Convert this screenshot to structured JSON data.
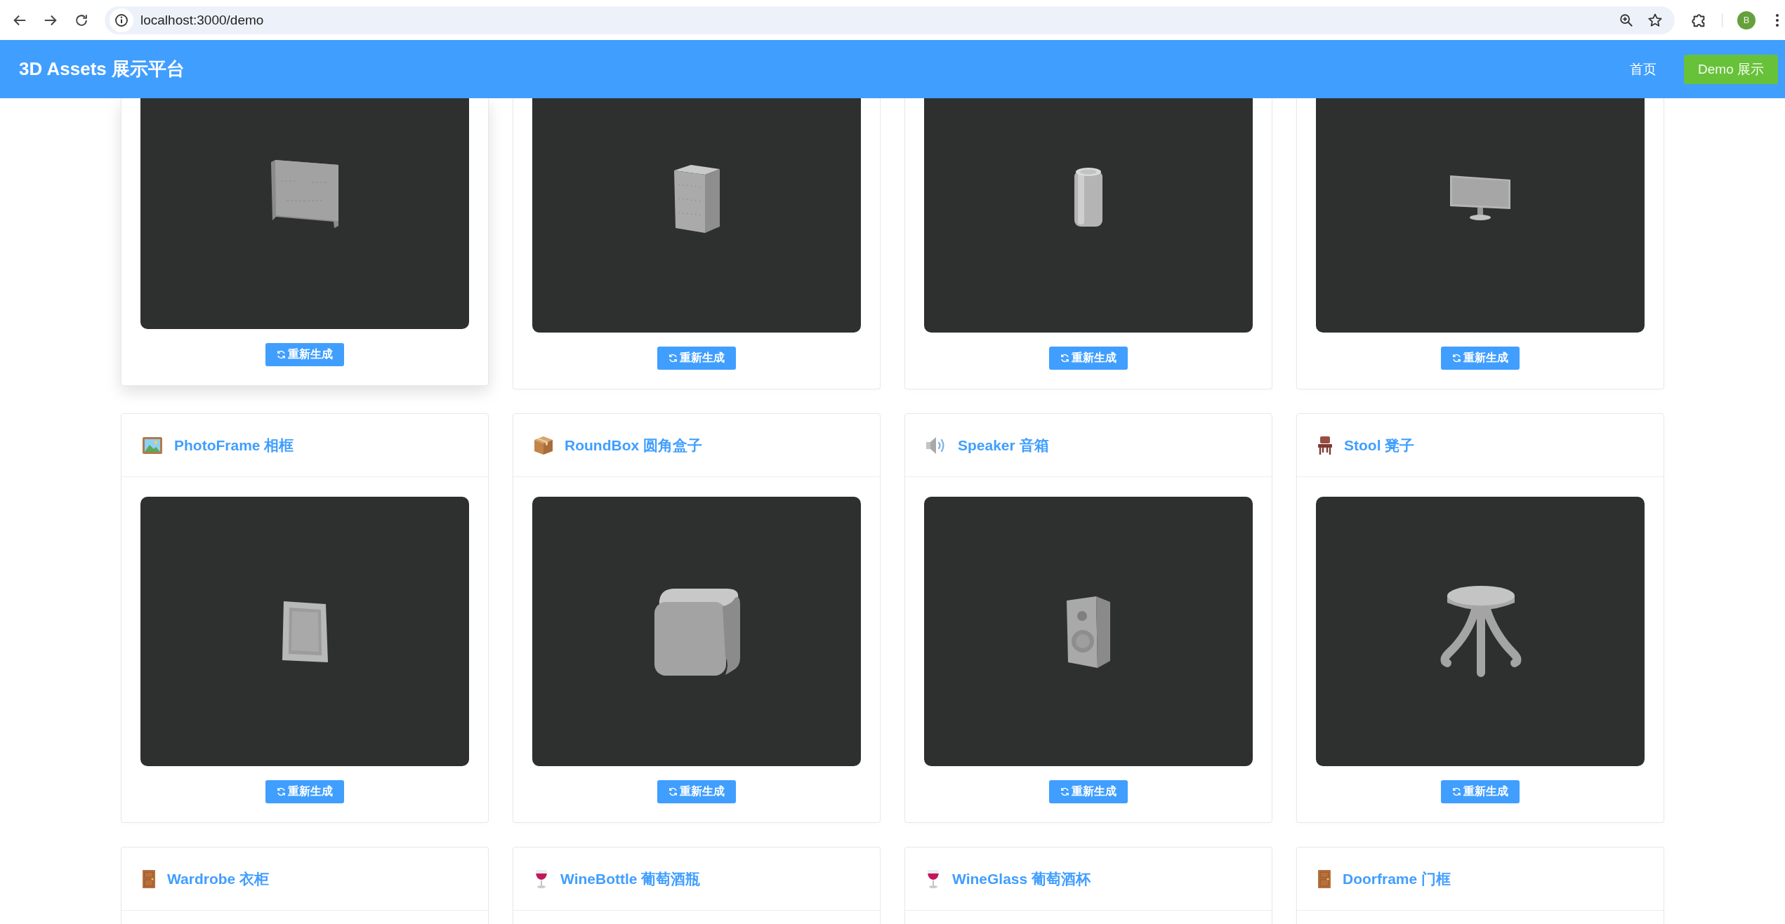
{
  "browser": {
    "url": "localhost:3000/demo",
    "profile": "B"
  },
  "header": {
    "title": "3D Assets 展示平台",
    "nav": [
      {
        "label": "首页",
        "selected": false
      },
      {
        "label": "Demo 展示",
        "selected": true
      }
    ]
  },
  "cards": [
    {
      "kind": "shelf",
      "hovered": true,
      "button": "重新生成"
    },
    {
      "kind": "cabinet",
      "hovered": false,
      "button": "重新生成"
    },
    {
      "kind": "can",
      "hovered": false,
      "button": "重新生成"
    },
    {
      "kind": "monitor",
      "hovered": false,
      "button": "重新生成"
    },
    {
      "kind": "frame",
      "title": "PhotoFrame 相框",
      "hovered": false,
      "button": "重新生成"
    },
    {
      "kind": "box",
      "title": "RoundBox 圆角盒子",
      "hovered": false,
      "button": "重新生成"
    },
    {
      "kind": "speaker",
      "title": "Speaker 音箱",
      "hovered": false,
      "button": "重新生成"
    },
    {
      "kind": "stool",
      "title": "Stool 凳子",
      "hovered": false,
      "button": "重新生成"
    },
    {
      "kind": "wardrobe",
      "title": "Wardrobe 衣柜",
      "hovered": false
    },
    {
      "kind": "bottle",
      "title": "WineBottle 葡萄酒瓶",
      "hovered": false
    },
    {
      "kind": "glass",
      "title": "WineGlass 葡萄酒杯",
      "hovered": false
    },
    {
      "kind": "doorframe",
      "title": "Doorframe 门框",
      "hovered": false
    }
  ]
}
